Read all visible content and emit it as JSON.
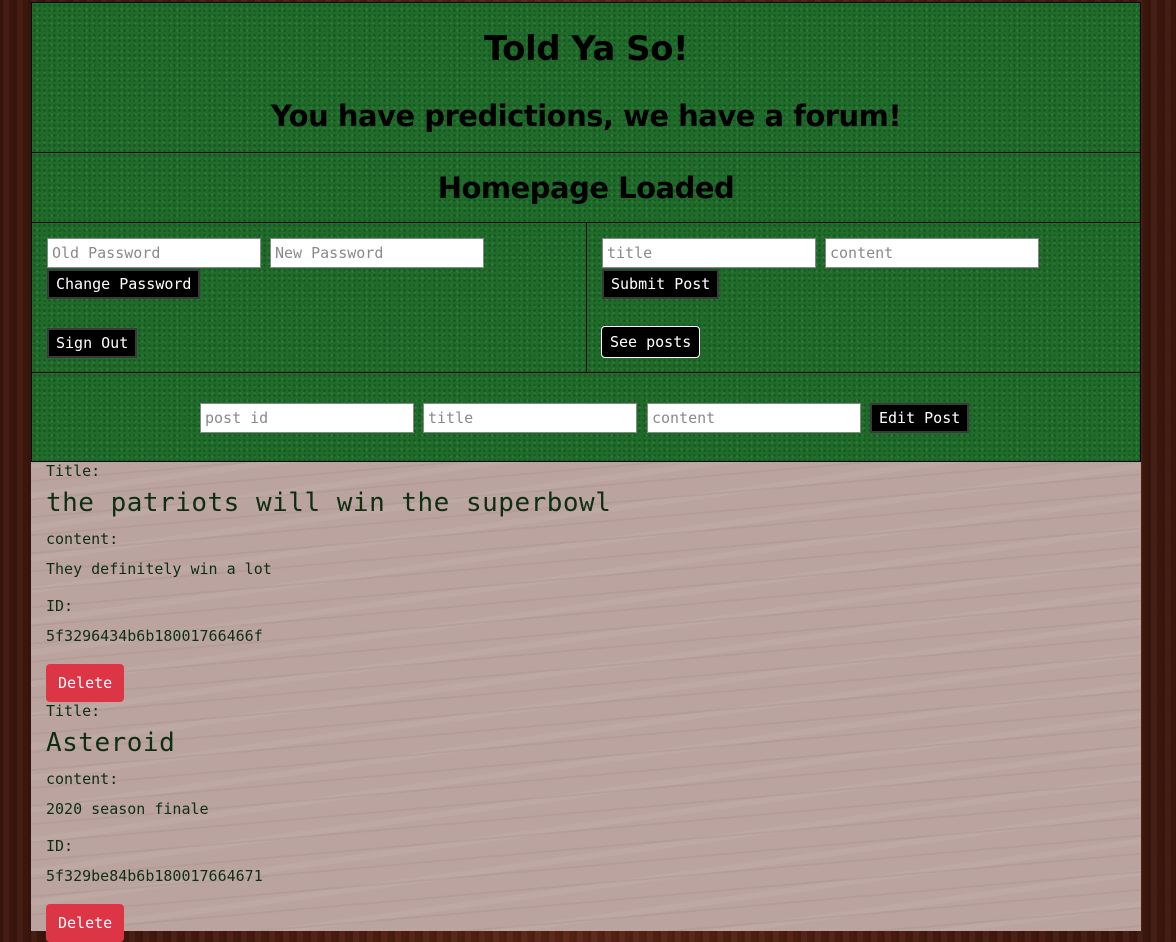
{
  "header": {
    "title": "Told Ya So!",
    "subtitle": "You have predictions, we have a forum!"
  },
  "status": {
    "message": "Homepage Loaded"
  },
  "account": {
    "old_password_placeholder": "Old Password",
    "new_password_placeholder": "New Password",
    "change_password_label": "Change Password",
    "sign_out_label": "Sign Out"
  },
  "new_post": {
    "title_placeholder": "title",
    "content_placeholder": "content",
    "submit_label": "Submit Post",
    "see_posts_label": "See posts"
  },
  "edit_post": {
    "post_id_placeholder": "post id",
    "title_placeholder": "title",
    "content_placeholder": "content",
    "edit_label": "Edit Post"
  },
  "posts": {
    "title_label": "Title:",
    "content_label": "content:",
    "id_label": "ID:",
    "delete_label": "Delete",
    "items": [
      {
        "title": "the patriots will win the superbowl",
        "content": "They definitely win a lot",
        "id": "5f3296434b6b18001766466f"
      },
      {
        "title": "Asteroid",
        "content": "2020 season finale",
        "id": "5f329be84b6b180017664671"
      }
    ]
  },
  "colors": {
    "felt_green": "#1f6b2a",
    "delete_red": "#dc3545",
    "text_dark_green": "#0e2e12"
  }
}
